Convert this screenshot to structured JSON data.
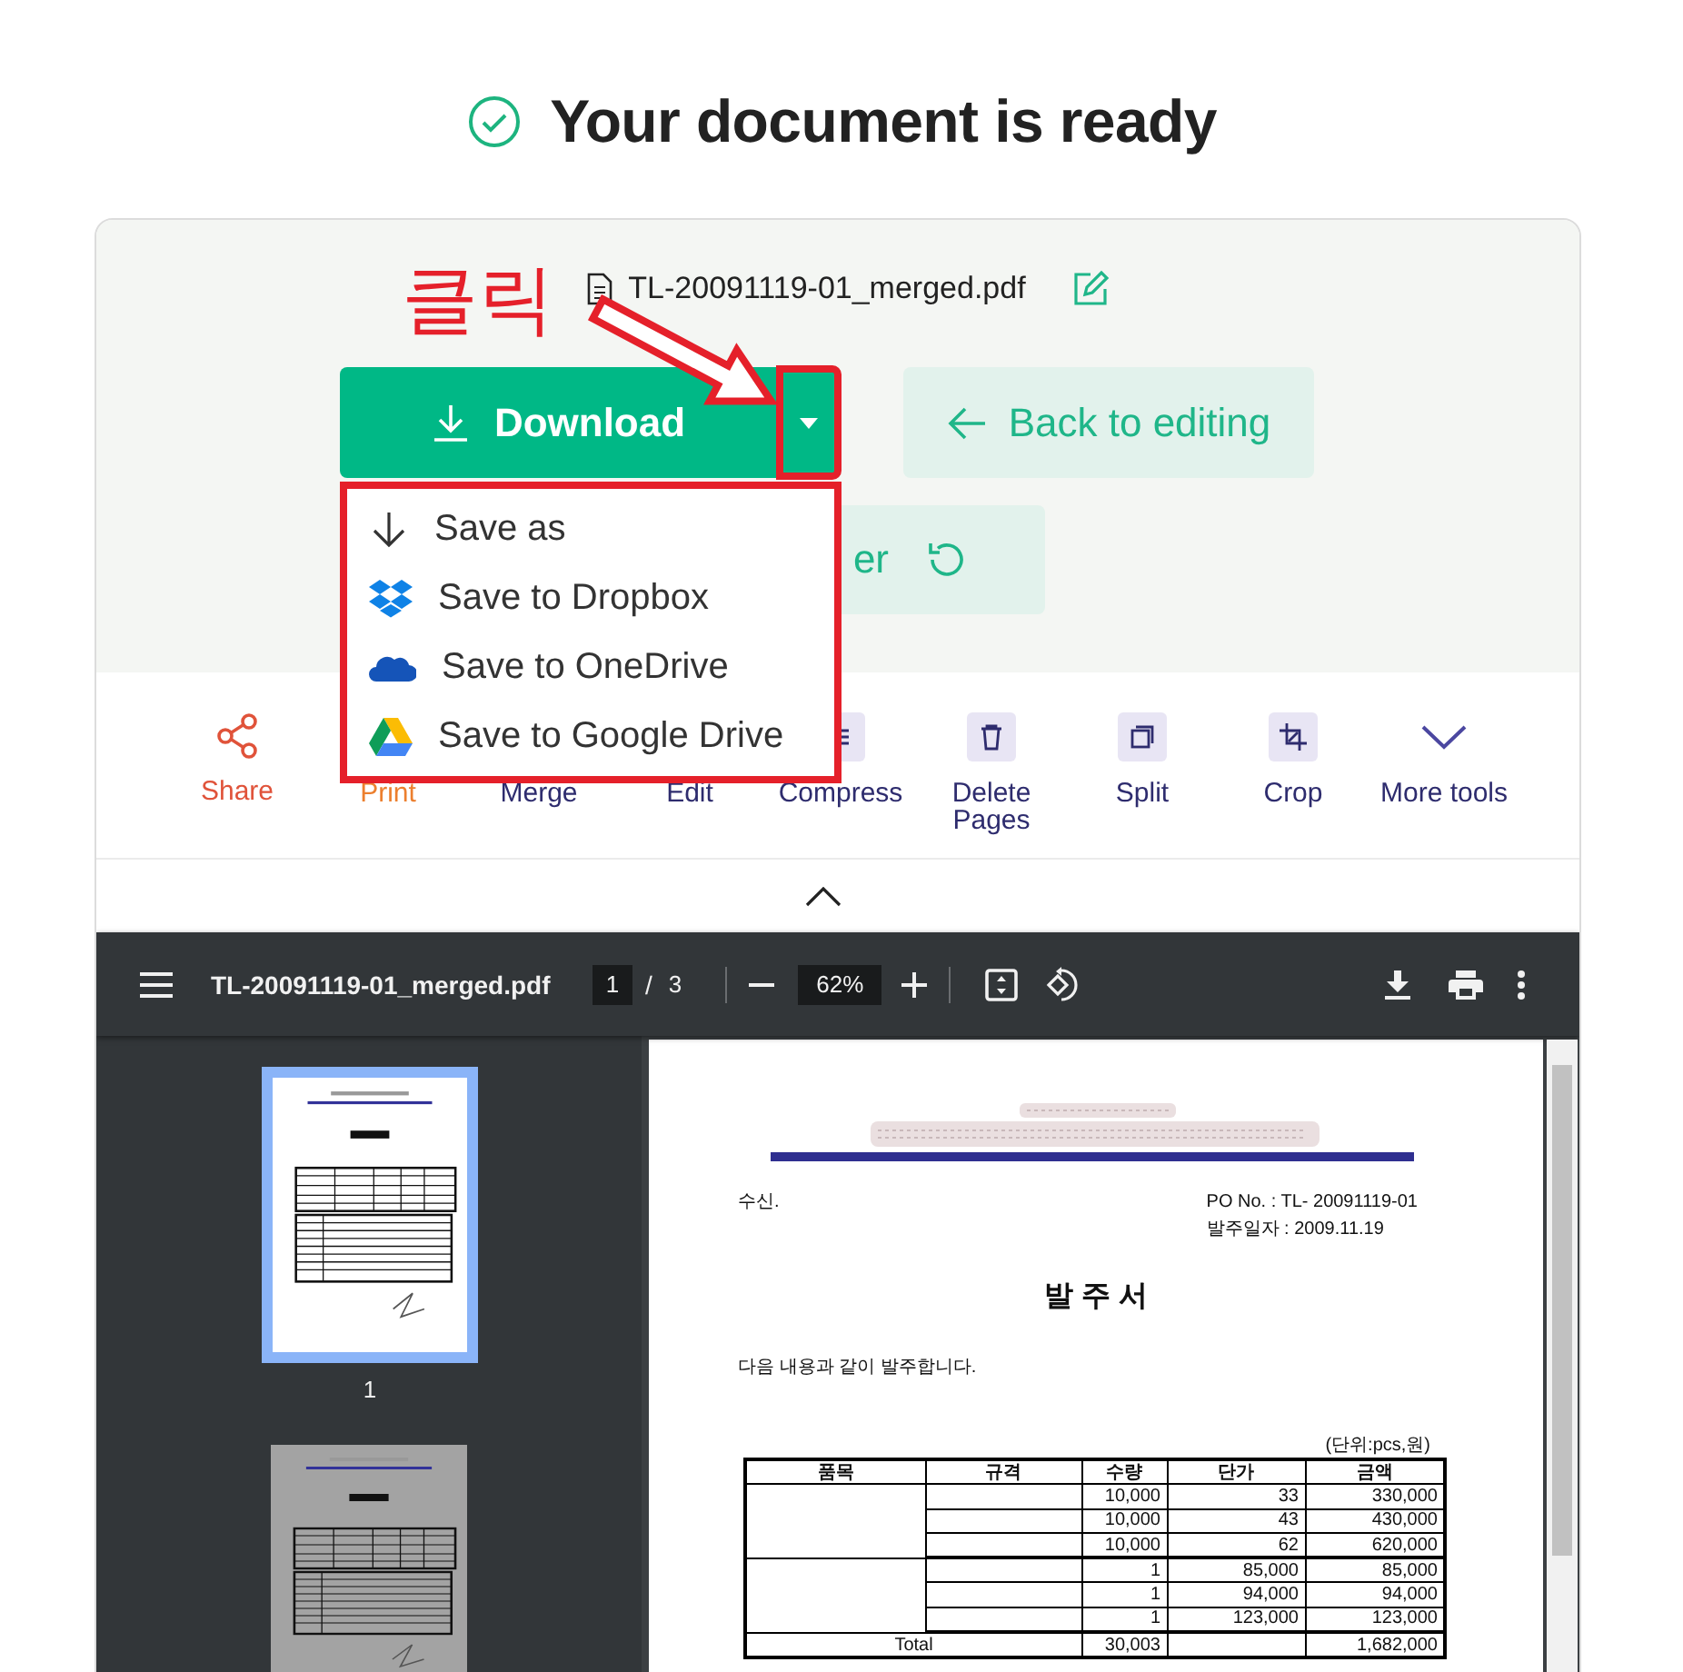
{
  "header": {
    "title": "Your document is ready"
  },
  "file": {
    "name": "TL-20091119-01_merged.pdf"
  },
  "annotation": {
    "label": "클릭"
  },
  "actions": {
    "download": {
      "label": "Download",
      "highlighted": true
    },
    "back": {
      "label": "Back to editing"
    },
    "start_over": {
      "label": "er"
    }
  },
  "save_menu": {
    "highlighted": true,
    "items": [
      {
        "kind": "save",
        "label": "Save as"
      },
      {
        "kind": "dropbox",
        "label": "Save to Dropbox"
      },
      {
        "kind": "onedrive",
        "label": "Save to OneDrive"
      },
      {
        "kind": "gdrive",
        "label": "Save to Google Drive"
      }
    ]
  },
  "tools": [
    {
      "kind": "share",
      "label": "Share",
      "color": "#e0533a"
    },
    {
      "kind": "covered",
      "label": "Print",
      "color": "#ec7f2e"
    },
    {
      "kind": "covered",
      "label": "Merge",
      "color": "#2e2c6e"
    },
    {
      "kind": "covered",
      "label": "Edit",
      "color": "#2e2c6e"
    },
    {
      "kind": "compress",
      "label": "Compress",
      "color": "#2e2c6e"
    },
    {
      "kind": "delete",
      "label": "Delete Pages",
      "color": "#2e2c6e"
    },
    {
      "kind": "split",
      "label": "Split",
      "color": "#2e2c6e"
    },
    {
      "kind": "crop",
      "label": "Crop",
      "color": "#2e2c6e"
    },
    {
      "kind": "more",
      "label": "More tools",
      "color": "#2e2c6e"
    }
  ],
  "viewer": {
    "file_name": "TL-20091119-01_merged.pdf",
    "page": "1",
    "page_separator": "/",
    "page_count": "3",
    "zoom": "62%",
    "thumbnails": [
      {
        "label": "1",
        "selected": true
      },
      {
        "selected": false
      }
    ],
    "document": {
      "recipient": "수신.",
      "po_no": "PO No. : TL- 20091119-01",
      "order_date": "발주일자 : 2009.11.19",
      "title": "발 주 서",
      "intro": "다음 내용과 같이 발주합니다.",
      "unit": "(단위:pcs,원)",
      "table": {
        "columns": [
          "품목",
          "규격",
          "수량",
          "단가",
          "금액"
        ],
        "groups": [
          {
            "rows": [
              {
                "quantity": "10,000",
                "unit_price": "33",
                "amount": "330,000"
              },
              {
                "quantity": "10,000",
                "unit_price": "43",
                "amount": "430,000"
              },
              {
                "quantity": "10,000",
                "unit_price": "62",
                "amount": "620,000"
              }
            ]
          },
          {
            "rows": [
              {
                "quantity": "1",
                "unit_price": "85,000",
                "amount": "85,000"
              },
              {
                "quantity": "1",
                "unit_price": "94,000",
                "amount": "94,000"
              },
              {
                "quantity": "1",
                "unit_price": "123,000",
                "amount": "123,000"
              }
            ]
          }
        ],
        "total": {
          "label": "Total",
          "quantity": "30,003",
          "amount": "1,682,000"
        }
      }
    }
  }
}
